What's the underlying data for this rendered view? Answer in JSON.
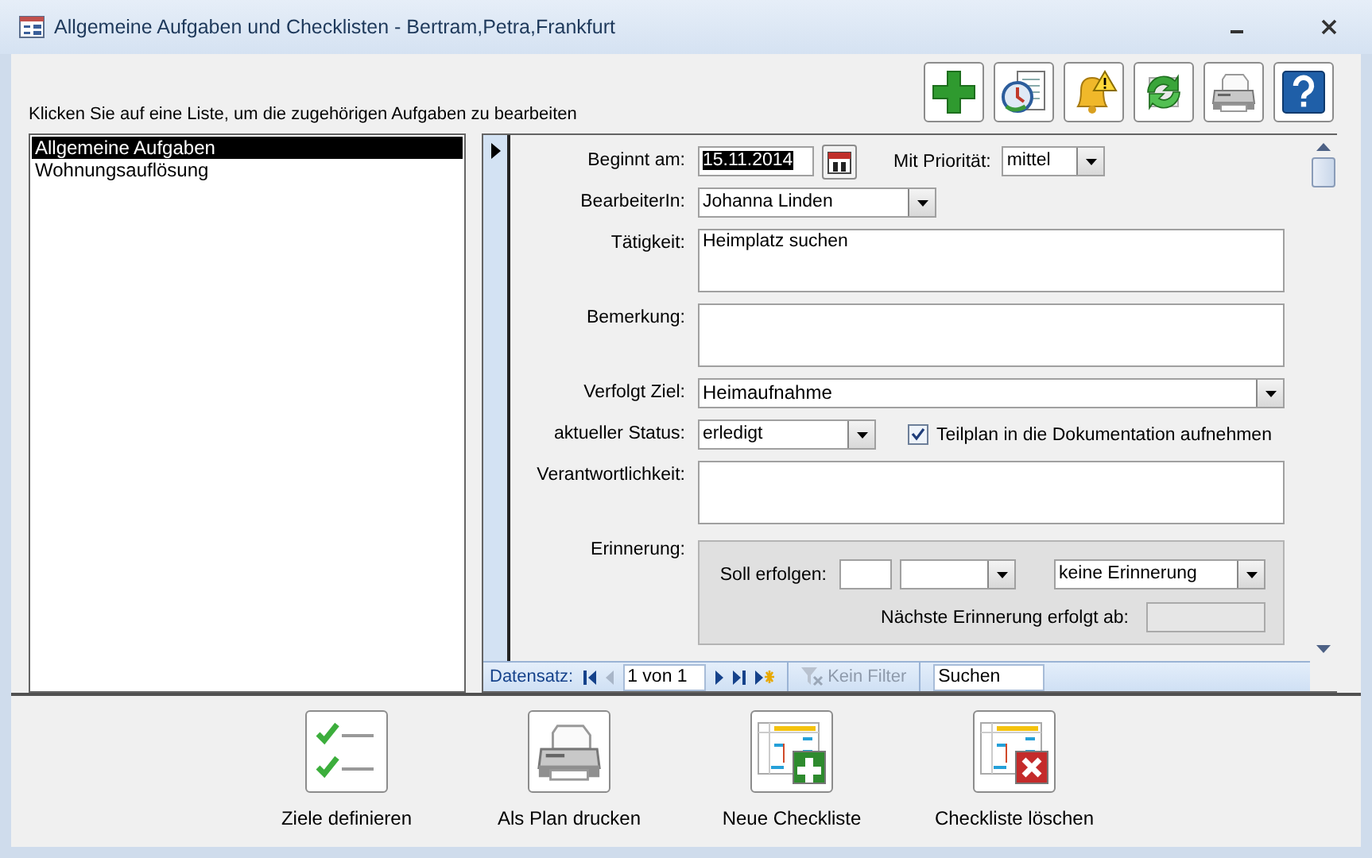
{
  "window": {
    "title": "Allgemeine Aufgaben und Checklisten - Bertram,Petra,Frankfurt"
  },
  "instruction": "Klicken Sie auf eine Liste, um die zugehörigen Aufgaben zu bearbeiten",
  "lists": [
    {
      "label": "Allgemeine Aufgaben",
      "selected": true
    },
    {
      "label": "Wohnungsauflösung",
      "selected": false
    }
  ],
  "form": {
    "start": {
      "label": "Beginnt am:",
      "value": "15.11.2014",
      "highlighted": true
    },
    "priority": {
      "label": "Mit Priorität:",
      "value": "mittel"
    },
    "editor": {
      "label": "BearbeiterIn:",
      "value": "Johanna Linden"
    },
    "activity": {
      "label": "Tätigkeit:",
      "value": "Heimplatz suchen"
    },
    "remark": {
      "label": "Bemerkung:"
    },
    "goal": {
      "label": "Verfolgt Ziel:",
      "value": "Heimaufnahme"
    },
    "status": {
      "label": "aktueller Status:",
      "value": "erledigt"
    },
    "include_in_docs": {
      "label": "Teilplan in die Dokumentation aufnehmen",
      "checked": true
    },
    "responsibility": {
      "label": "Verantwortlichkeit:"
    },
    "reminder": {
      "label": "Erinnerung:",
      "due_label": "Soll erfolgen:",
      "mode": "keine Erinnerung",
      "next_label": "Nächste Erinnerung erfolgt ab:"
    }
  },
  "nav": {
    "label": "Datensatz:",
    "position": "1 von 1",
    "filter": {
      "label": "Kein Filter",
      "disabled": true
    },
    "search": "Suchen"
  },
  "actions": [
    "Ziele definieren",
    "Als Plan drucken",
    "Neue Checkliste",
    "Checkliste löschen"
  ]
}
